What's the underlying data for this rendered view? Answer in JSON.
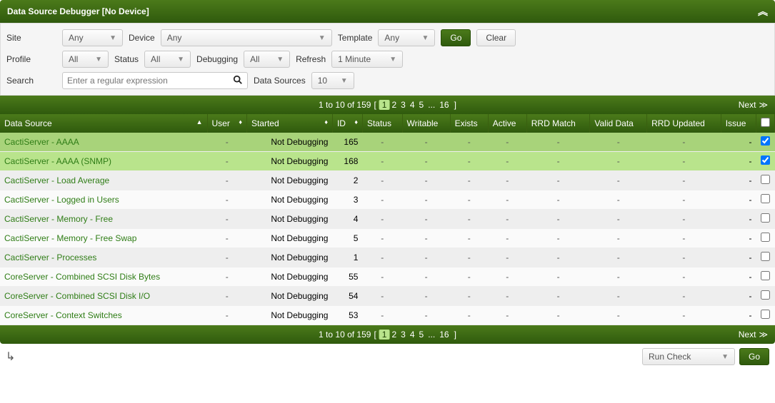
{
  "header": {
    "title": "Data Source Debugger [No Device]"
  },
  "filters": {
    "site": {
      "label": "Site",
      "value": "Any"
    },
    "device": {
      "label": "Device",
      "value": "Any"
    },
    "template": {
      "label": "Template",
      "value": "Any"
    },
    "go": "Go",
    "clear": "Clear",
    "profile": {
      "label": "Profile",
      "value": "All"
    },
    "status": {
      "label": "Status",
      "value": "All"
    },
    "debugging": {
      "label": "Debugging",
      "value": "All"
    },
    "refresh": {
      "label": "Refresh",
      "value": "1 Minute"
    },
    "search": {
      "label": "Search",
      "placeholder": "Enter a regular expression"
    },
    "datasources": {
      "label": "Data Sources",
      "value": "10"
    }
  },
  "pager": {
    "summary": "1 to 10 of 159",
    "pages": [
      "1",
      "2",
      "3",
      "4",
      "5",
      "...",
      "16"
    ],
    "current": "1",
    "next": "Next"
  },
  "columns": {
    "dataSource": "Data Source",
    "user": "User",
    "started": "Started",
    "id": "ID",
    "status": "Status",
    "writable": "Writable",
    "exists": "Exists",
    "active": "Active",
    "rrdMatch": "RRD Match",
    "validData": "Valid Data",
    "rrdUpdated": "RRD Updated",
    "issue": "Issue"
  },
  "rows": [
    {
      "name": "CactiServer - AAAA",
      "user": "-",
      "started": "Not Debugging",
      "id": "165",
      "status": "-",
      "writable": "-",
      "exists": "-",
      "active": "-",
      "rrdMatch": "-",
      "validData": "-",
      "rrdUpdated": "-",
      "issue": "-",
      "checked": true,
      "sel": true
    },
    {
      "name": "CactiServer - AAAA (SNMP)",
      "user": "-",
      "started": "Not Debugging",
      "id": "168",
      "status": "-",
      "writable": "-",
      "exists": "-",
      "active": "-",
      "rrdMatch": "-",
      "validData": "-",
      "rrdUpdated": "-",
      "issue": "-",
      "checked": true,
      "sel": true
    },
    {
      "name": "CactiServer - Load Average",
      "user": "-",
      "started": "Not Debugging",
      "id": "2",
      "status": "-",
      "writable": "-",
      "exists": "-",
      "active": "-",
      "rrdMatch": "-",
      "validData": "-",
      "rrdUpdated": "-",
      "issue": "-",
      "checked": false,
      "sel": false
    },
    {
      "name": "CactiServer - Logged in Users",
      "user": "-",
      "started": "Not Debugging",
      "id": "3",
      "status": "-",
      "writable": "-",
      "exists": "-",
      "active": "-",
      "rrdMatch": "-",
      "validData": "-",
      "rrdUpdated": "-",
      "issue": "-",
      "checked": false,
      "sel": false
    },
    {
      "name": "CactiServer - Memory - Free",
      "user": "-",
      "started": "Not Debugging",
      "id": "4",
      "status": "-",
      "writable": "-",
      "exists": "-",
      "active": "-",
      "rrdMatch": "-",
      "validData": "-",
      "rrdUpdated": "-",
      "issue": "-",
      "checked": false,
      "sel": false
    },
    {
      "name": "CactiServer - Memory - Free Swap",
      "user": "-",
      "started": "Not Debugging",
      "id": "5",
      "status": "-",
      "writable": "-",
      "exists": "-",
      "active": "-",
      "rrdMatch": "-",
      "validData": "-",
      "rrdUpdated": "-",
      "issue": "-",
      "checked": false,
      "sel": false
    },
    {
      "name": "CactiServer - Processes",
      "user": "-",
      "started": "Not Debugging",
      "id": "1",
      "status": "-",
      "writable": "-",
      "exists": "-",
      "active": "-",
      "rrdMatch": "-",
      "validData": "-",
      "rrdUpdated": "-",
      "issue": "-",
      "checked": false,
      "sel": false
    },
    {
      "name": "CoreServer - Combined SCSI Disk Bytes",
      "user": "-",
      "started": "Not Debugging",
      "id": "55",
      "status": "-",
      "writable": "-",
      "exists": "-",
      "active": "-",
      "rrdMatch": "-",
      "validData": "-",
      "rrdUpdated": "-",
      "issue": "-",
      "checked": false,
      "sel": false
    },
    {
      "name": "CoreServer - Combined SCSI Disk I/O",
      "user": "-",
      "started": "Not Debugging",
      "id": "54",
      "status": "-",
      "writable": "-",
      "exists": "-",
      "active": "-",
      "rrdMatch": "-",
      "validData": "-",
      "rrdUpdated": "-",
      "issue": "-",
      "checked": false,
      "sel": false
    },
    {
      "name": "CoreServer - Context Switches",
      "user": "-",
      "started": "Not Debugging",
      "id": "53",
      "status": "-",
      "writable": "-",
      "exists": "-",
      "active": "-",
      "rrdMatch": "-",
      "validData": "-",
      "rrdUpdated": "-",
      "issue": "-",
      "checked": false,
      "sel": false
    }
  ],
  "footer": {
    "action": "Run Check",
    "go": "Go"
  }
}
